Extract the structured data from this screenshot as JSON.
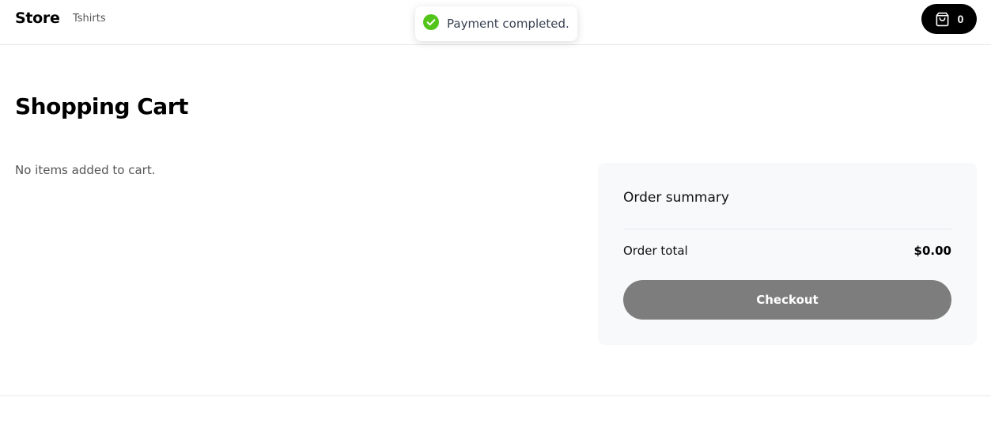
{
  "navbar": {
    "brand": "Store",
    "links": [
      {
        "label": "Tshirts"
      }
    ],
    "cart": {
      "count": "0",
      "icon": "shopping-bag-icon"
    }
  },
  "toast": {
    "message": "Payment completed.",
    "icon": "check-circle-icon",
    "icon_color": "#52c41a"
  },
  "main": {
    "title": "Shopping Cart",
    "empty_message": "No items added to cart."
  },
  "summary": {
    "title": "Order summary",
    "total_label": "Order total",
    "total_value": "$0.00",
    "checkout_label": "Checkout"
  },
  "colors": {
    "cart_button_bg": "#000000",
    "checkout_button_bg": "#7c7d7c",
    "summary_bg": "#f8f9fb"
  }
}
